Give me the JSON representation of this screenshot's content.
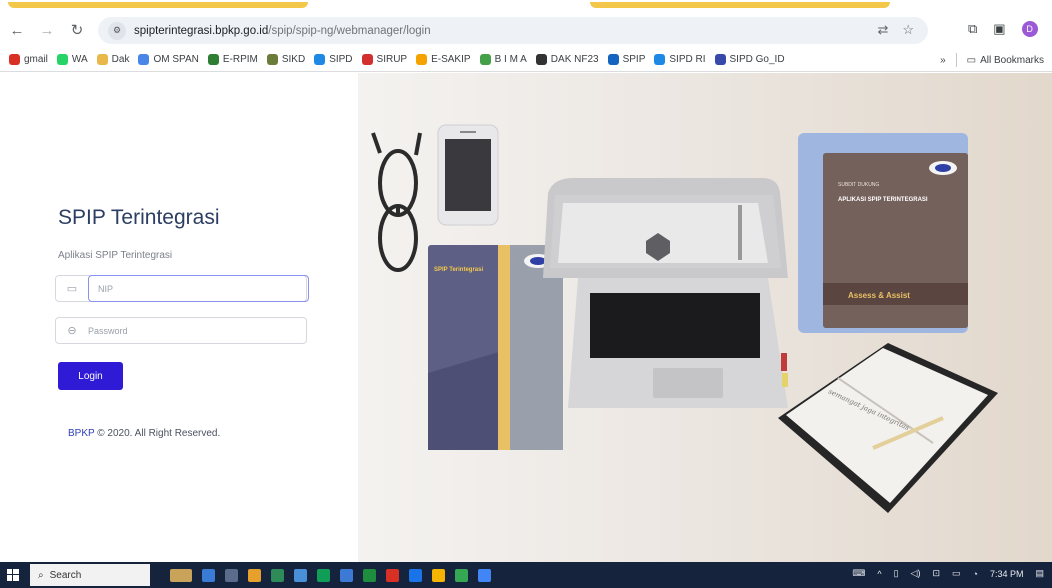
{
  "browser": {
    "url_domain": "spipterintegrasi.bpkp.go.id",
    "url_path": "/spip/spip-ng/webmanager/login",
    "site_info_icon": "tune-icon",
    "bookmarks": [
      {
        "label": "gmail",
        "icon": "gmail-icon",
        "color": "#d93025"
      },
      {
        "label": "WA",
        "icon": "whatsapp-icon",
        "color": "#25d366"
      },
      {
        "label": "Dak",
        "icon": "dak-icon",
        "color": "#e8b94a"
      },
      {
        "label": "OM SPAN",
        "icon": "omspan-icon",
        "color": "#4a86e8"
      },
      {
        "label": "E-RPIM",
        "icon": "erpim-icon",
        "color": "#2e7d32"
      },
      {
        "label": "SIKD",
        "icon": "sikd-icon",
        "color": "#6b7b3a"
      },
      {
        "label": "SIPD",
        "icon": "sipd-icon",
        "color": "#1e88e5"
      },
      {
        "label": "SIRUP",
        "icon": "sirup-icon",
        "color": "#d32f2f"
      },
      {
        "label": "E-SAKIP",
        "icon": "esakip-icon",
        "color": "#f4a300"
      },
      {
        "label": "B I M A",
        "icon": "bima-icon",
        "color": "#43a047"
      },
      {
        "label": "DAK NF23",
        "icon": "daknf-icon",
        "color": "#333333"
      },
      {
        "label": "SPIP",
        "icon": "spip-icon",
        "color": "#1565c0"
      },
      {
        "label": "SIPD RI",
        "icon": "sipdri-icon",
        "color": "#1e88e5"
      },
      {
        "label": "SIPD Go_ID",
        "icon": "sipdgo-icon",
        "color": "#3949ab"
      }
    ],
    "bookmarks_overflow": "»",
    "all_bookmarks": "All Bookmarks"
  },
  "login": {
    "title": "SPIP Terintegrasi",
    "subtitle": "Aplikasi SPIP Terintegrasi",
    "nip_placeholder": "NIP",
    "password_placeholder": "Password",
    "login_button": "Login",
    "copyright_brand": "BPKP",
    "copyright_text": " © 2020. All Right Reserved."
  },
  "hero": {
    "book_left_title": "SPIP Terintegrasi",
    "book_right_title": "APLIKASI SPIP TERINTEGRASI",
    "book_right_banner": "Assess & Assist",
    "book_right_tag": "SUBDIT DUKUNG",
    "notebook_text": "semangat jaga integritas"
  },
  "taskbar": {
    "search_label": "Search",
    "time": "7:34 PM"
  },
  "colors": {
    "accent": "#2f1bd6",
    "title": "#2c3e63",
    "focus_border": "#8a92f0"
  }
}
